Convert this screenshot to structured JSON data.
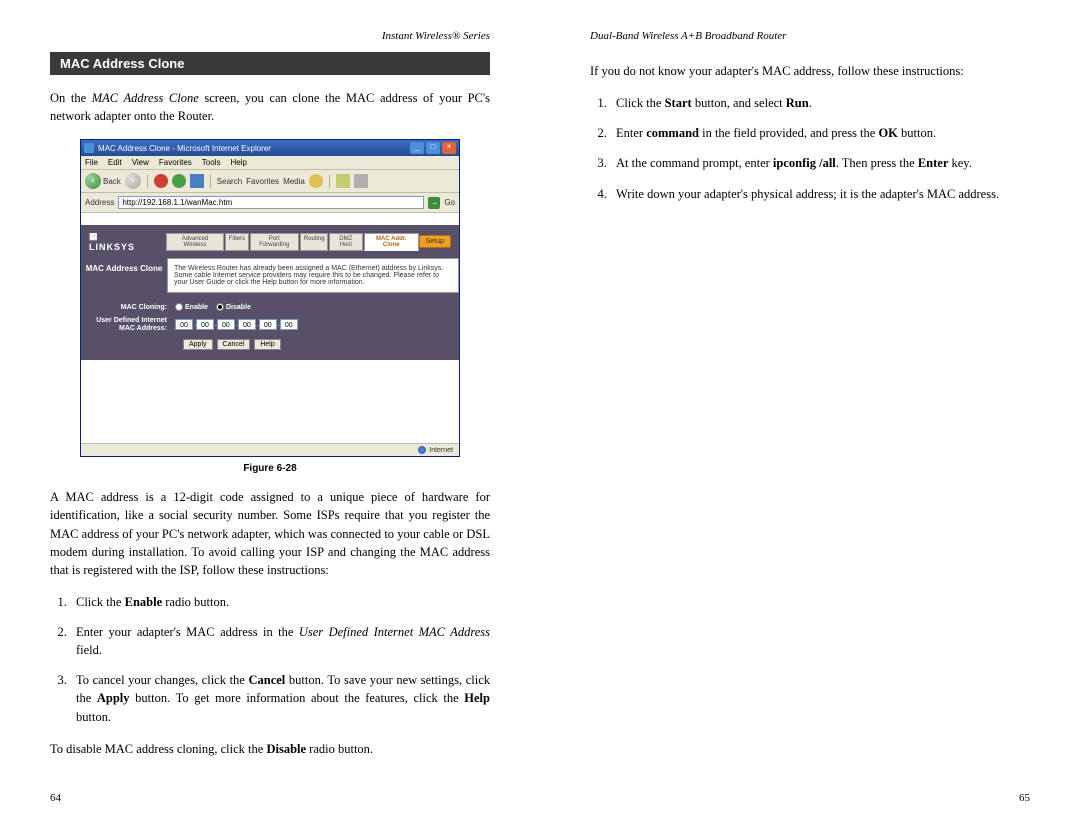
{
  "left": {
    "header": "Instant Wireless® Series",
    "section_heading": "MAC Address Clone",
    "intro_pre": "On the ",
    "intro_italic": "MAC Address Clone",
    "intro_post": " screen, you can clone the MAC address of your PC's network adapter onto the Router.",
    "fig_caption": "Figure 6-28",
    "mac_para": "A MAC address is a 12-digit code assigned to a unique piece of hardware for identification, like a social security number. Some ISPs require that you register the MAC address of your PC's network adapter, which was connected to your cable or DSL modem during installation. To avoid calling your ISP and changing the MAC address that is registered with the ISP, follow these instructions:",
    "step1_a": "Click the ",
    "step1_b": "Enable",
    "step1_c": " radio button.",
    "step2_a": "Enter your adapter's MAC address in the ",
    "step2_b": "User Defined Internet MAC Address",
    "step2_c": " field.",
    "step3_a": "To cancel your changes, click the ",
    "step3_b": "Cancel",
    "step3_c": " button. To save your new settings, click the ",
    "step3_d": "Apply",
    "step3_e": " button. To get more information about the features, click the ",
    "step3_f": "Help",
    "step3_g": " button.",
    "disable_a": "To disable MAC address cloning, click the ",
    "disable_b": "Disable",
    "disable_c": " radio button.",
    "page_num": "64"
  },
  "right": {
    "header": "Dual-Band Wireless A+B Broadband Router",
    "intro": "If you do not know your adapter's MAC address, follow these instructions:",
    "r1_a": "Click the ",
    "r1_b": "Start",
    "r1_c": " button, and select ",
    "r1_d": "Run",
    "r1_e": ".",
    "r2_a": "Enter ",
    "r2_b": "command",
    "r2_c": " in the field provided, and press the ",
    "r2_d": "OK",
    "r2_e": " button.",
    "r3_a": "At the command prompt, enter ",
    "r3_b": "ipconfig /all",
    "r3_c": ". Then press the ",
    "r3_d": "Enter",
    "r3_e": " key.",
    "r4": "Write down your adapter's physical address; it is the adapter's MAC address.",
    "page_num": "65"
  },
  "screenshot": {
    "title": "MAC Address Clone - Microsoft Internet Explorer",
    "menus": [
      "File",
      "Edit",
      "View",
      "Favorites",
      "Tools",
      "Help"
    ],
    "back": "Back",
    "toolbar_search": "Search",
    "toolbar_fav": "Favorites",
    "toolbar_media": "Media",
    "addr_label": "Address",
    "addr_value": "http://192.168.1.1/wanMac.htm",
    "go": "Go",
    "brand": "LINKSYS",
    "tabs": [
      "Advanced Wireless",
      "Filters",
      "Port Forwarding",
      "Routing",
      "DMZ Host",
      "MAC Addr. Clone"
    ],
    "setup": "Setup",
    "sidebar": "MAC Address Clone",
    "desc": "The Wireless Router has already been assigned a MAC (Ethernet) address by Linksys. Some cable Internet service providers may require this to be changed. Please refer to your User Guide or click the Help button for more information.",
    "label_cloning": "MAC Cloning:",
    "opt_enable": "Enable",
    "opt_disable": "Disable",
    "label_mac": "User Defined Internet MAC Address:",
    "mac_vals": [
      "00",
      "00",
      "00",
      "00",
      "00",
      "00"
    ],
    "btn_apply": "Apply",
    "btn_cancel": "Cancel",
    "btn_help": "Help",
    "status": "Internet"
  }
}
